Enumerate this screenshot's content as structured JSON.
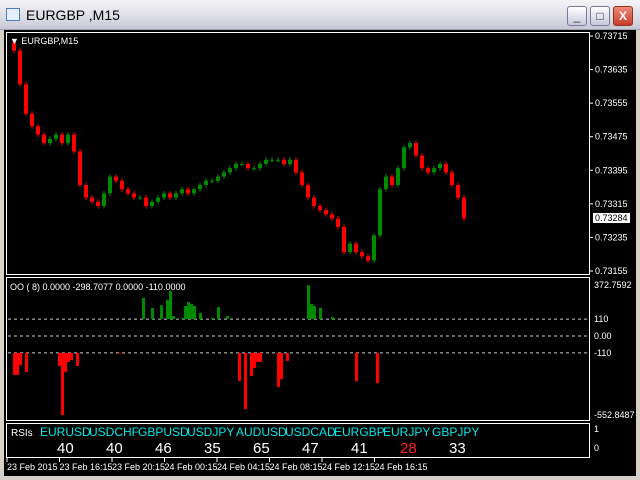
{
  "window": {
    "title": "EURGBP ,M15",
    "minimize": "_",
    "maximize": "□",
    "close": "X"
  },
  "chart": {
    "label": "EURGBP,M15",
    "current_price": "0.73284",
    "price_ticks": [
      "0.73715",
      "0.73635",
      "0.73555",
      "0.73475",
      "0.73395",
      "0.73315",
      "0.73235",
      "0.73155"
    ],
    "price_range": [
      0.73155,
      0.73715
    ],
    "closes": [
      0.7368,
      0.736,
      0.7353,
      0.735,
      0.7348,
      0.7346,
      0.7347,
      0.7348,
      0.7346,
      0.7348,
      0.7344,
      0.7336,
      0.7333,
      0.7332,
      0.7331,
      0.7334,
      0.7338,
      0.7337,
      0.7335,
      0.7334,
      0.7333,
      0.7333,
      0.7331,
      0.7332,
      0.7333,
      0.7334,
      0.7333,
      0.7334,
      0.7335,
      0.7334,
      0.7335,
      0.7336,
      0.7337,
      0.7337,
      0.7338,
      0.7339,
      0.734,
      0.7341,
      0.7341,
      0.734,
      0.734,
      0.7341,
      0.7342,
      0.7342,
      0.7342,
      0.7341,
      0.7342,
      0.7339,
      0.7336,
      0.7333,
      0.7331,
      0.733,
      0.7329,
      0.7328,
      0.7326,
      0.732,
      0.7322,
      0.732,
      0.7319,
      0.7318,
      0.7324,
      0.7335,
      0.7338,
      0.7336,
      0.734,
      0.7345,
      0.7346,
      0.7343,
      0.734,
      0.7339,
      0.734,
      0.7341,
      0.7339,
      0.7336,
      0.7333,
      0.7328
    ],
    "bull_color": "#008a00",
    "bear_color": "#ff0000"
  },
  "indicator": {
    "label": "OO (  8) 0.0000 -298.7077 0.0000 -110.0000",
    "ticks": [
      "372.7592",
      "110",
      "0.00",
      "-110",
      "-552.8487"
    ],
    "levels": [
      110,
      0,
      -110
    ],
    "bars": [
      {
        "bar": 44,
        "value": 247
      },
      {
        "bar": 47,
        "value": 182
      },
      {
        "bar": 50,
        "value": 200
      },
      {
        "bar": 52,
        "value": 234
      },
      {
        "bar": 53,
        "value": 293
      },
      {
        "bar": 54,
        "value": 130
      },
      {
        "bar": 57,
        "value": 117
      },
      {
        "bar": 58,
        "value": 195
      },
      {
        "bar": 59,
        "value": 221
      },
      {
        "bar": 60,
        "value": 208
      },
      {
        "bar": 61,
        "value": 195
      },
      {
        "bar": 63,
        "value": 150
      },
      {
        "bar": 67,
        "value": 117
      },
      {
        "bar": 69,
        "value": 188
      },
      {
        "bar": 72,
        "value": 130
      },
      {
        "bar": 99,
        "value": 330
      },
      {
        "bar": 100,
        "value": 208
      },
      {
        "bar": 101,
        "value": 195
      },
      {
        "bar": 103,
        "value": 182
      },
      {
        "bar": 107,
        "value": 124
      },
      {
        "bar": 108,
        "value": 114
      },
      {
        "bar": 1,
        "value": -253
      },
      {
        "bar": 2,
        "value": -253
      },
      {
        "bar": 3,
        "value": -189
      },
      {
        "bar": 5,
        "value": -234
      },
      {
        "bar": 16,
        "value": -195
      },
      {
        "bar": 17,
        "value": -514
      },
      {
        "bar": 18,
        "value": -234
      },
      {
        "bar": 19,
        "value": -169
      },
      {
        "bar": 20,
        "value": -156
      },
      {
        "bar": 22,
        "value": -195
      },
      {
        "bar": 36,
        "value": -115
      },
      {
        "bar": 76,
        "value": -292
      },
      {
        "bar": 78,
        "value": -475
      },
      {
        "bar": 80,
        "value": -260
      },
      {
        "bar": 81,
        "value": -208
      },
      {
        "bar": 82,
        "value": -169
      },
      {
        "bar": 83,
        "value": -169
      },
      {
        "bar": 89,
        "value": -332
      },
      {
        "bar": 90,
        "value": -280
      },
      {
        "bar": 92,
        "value": -162
      },
      {
        "bar": 115,
        "value": -293
      },
      {
        "bar": 122,
        "value": -306
      }
    ],
    "pos_color": "#008a00",
    "neg_color": "#ff0000"
  },
  "rsi": {
    "label": "RSIs",
    "ticks": [
      "1",
      "0"
    ],
    "items": [
      {
        "pair": "EURUSD",
        "value": "40",
        "color": "#ffffff"
      },
      {
        "pair": "USDCHF",
        "value": "40",
        "color": "#ffffff"
      },
      {
        "pair": "GBPUSD",
        "value": "46",
        "color": "#ffffff"
      },
      {
        "pair": "USDJPY",
        "value": "35",
        "color": "#ffffff"
      },
      {
        "pair": "AUDUSD",
        "value": "65",
        "color": "#ffffff"
      },
      {
        "pair": "USDCAD",
        "value": "47",
        "color": "#ffffff"
      },
      {
        "pair": "EURGBP",
        "value": "41",
        "color": "#ffffff"
      },
      {
        "pair": "EURJPY",
        "value": "28",
        "color": "#ff2020"
      },
      {
        "pair": "GBPJPY",
        "value": "33",
        "color": "#ffffff"
      }
    ]
  },
  "time_axis": [
    "23 Feb 2015",
    "23 Feb 16:15",
    "23 Feb 20:15",
    "24 Feb 00:15",
    "24 Feb 04:15",
    "24 Feb 08:15",
    "24 Feb 12:15",
    "24 Feb 16:15"
  ]
}
